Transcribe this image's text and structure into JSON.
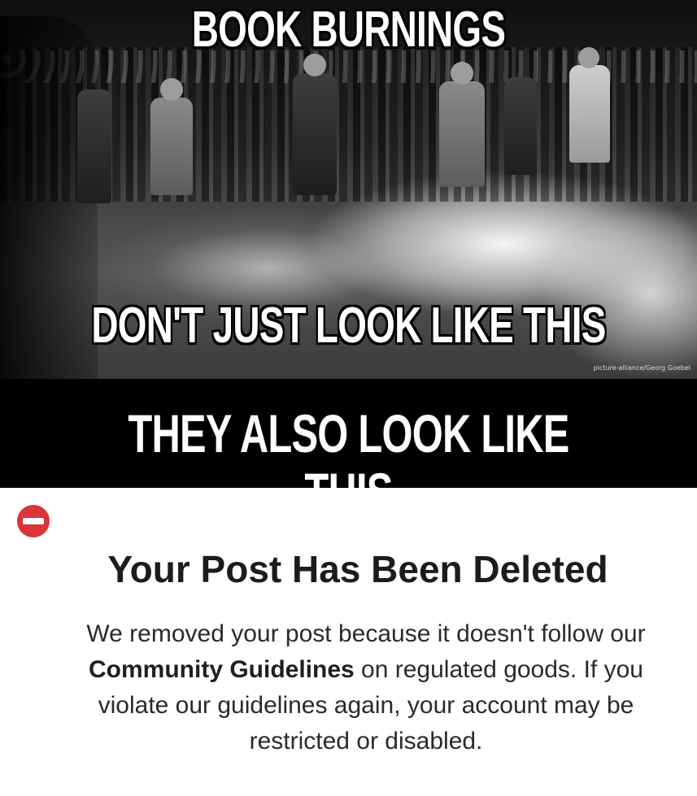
{
  "meme": {
    "caption_top": "BOOK BURNINGS",
    "caption_middle": "DON'T JUST LOOK LIKE THIS",
    "caption_bottom": "THEY ALSO LOOK LIKE THIS",
    "photo_credit": "picture-alliance/Georg Goebel"
  },
  "notice": {
    "icon": "no-entry-icon",
    "icon_color": "#d9353a",
    "title": "Your Post Has Been Deleted",
    "body_part1": "We removed your post because it doesn't follow our ",
    "body_bold": "Community Guidelines",
    "body_part2": " on regulated goods. If you violate our guidelines again, your account may be restricted or disabled."
  }
}
